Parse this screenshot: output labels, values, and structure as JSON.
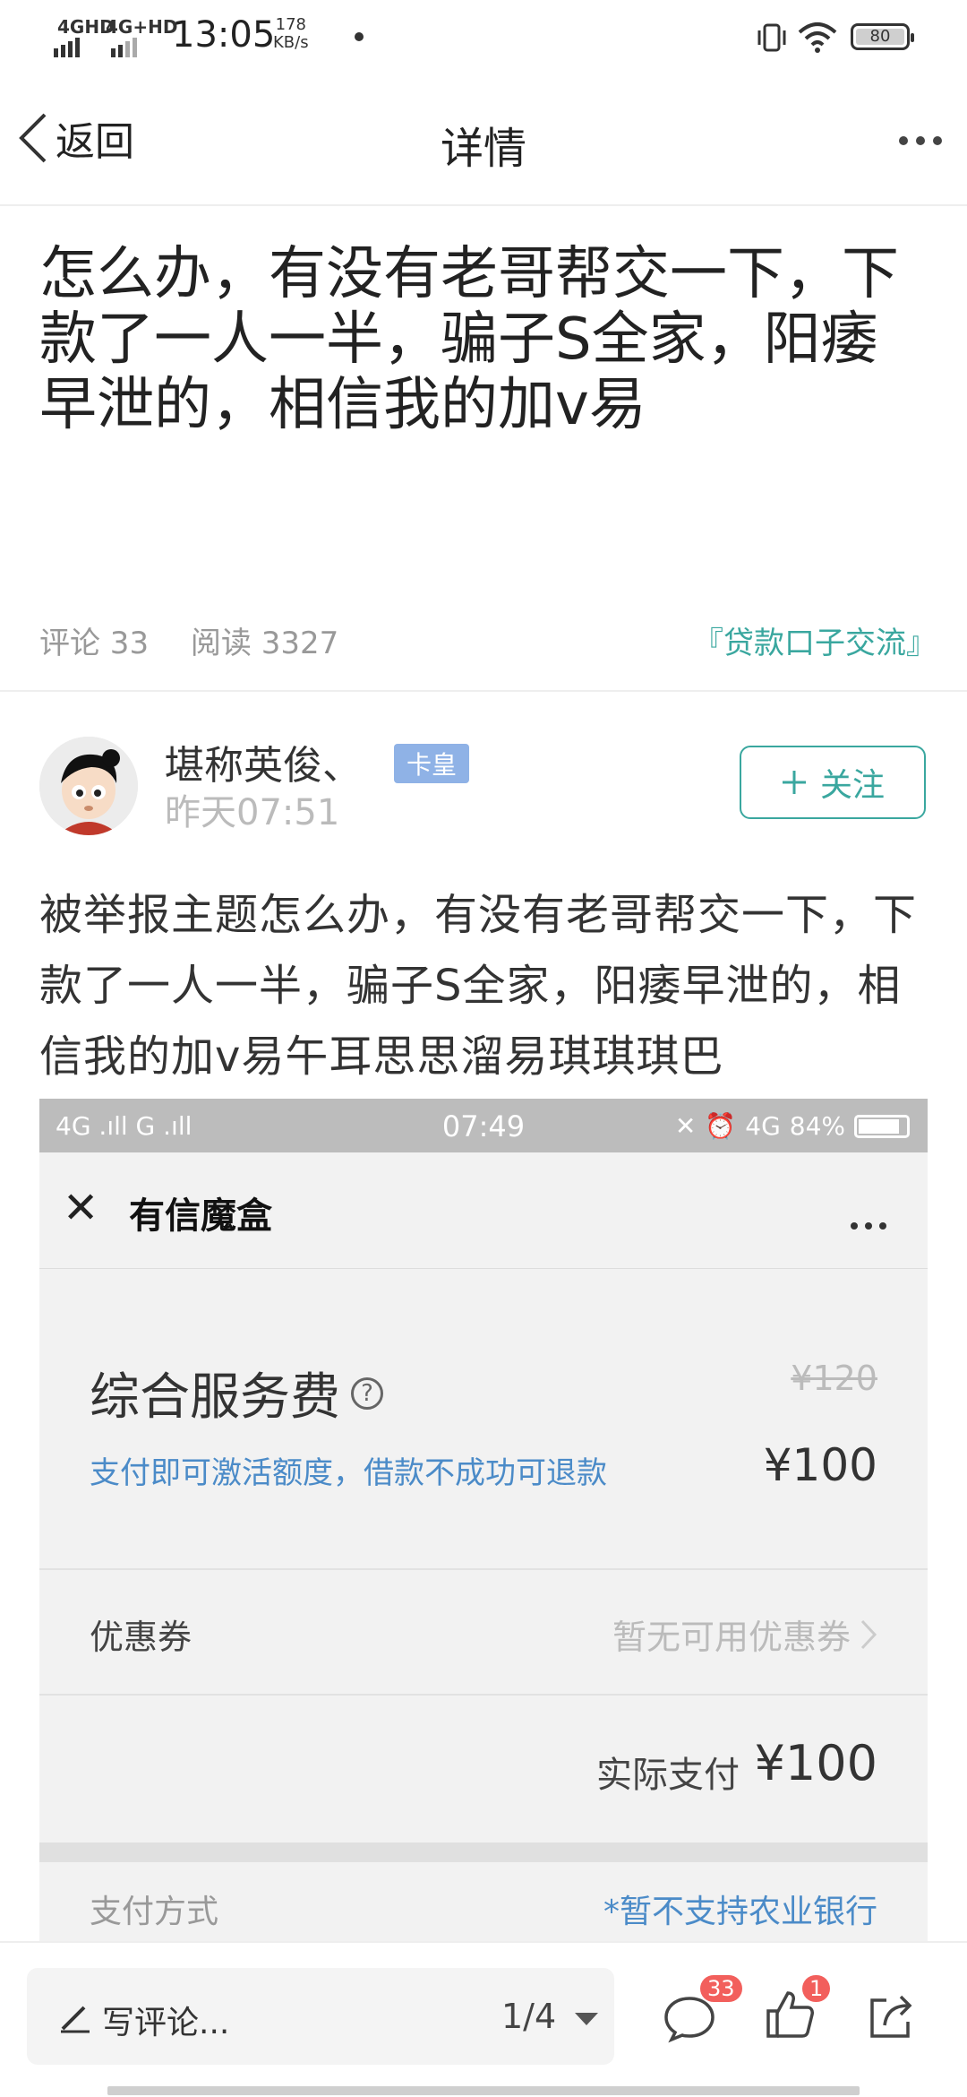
{
  "status": {
    "net1": "4GHD",
    "net2": "4G+HD",
    "time": "13:05",
    "speed_value": "178",
    "speed_unit": "KB/s",
    "battery": "80"
  },
  "nav": {
    "back_label": "返回",
    "title": "详情"
  },
  "post": {
    "title": "怎么办，有没有老哥帮交一下，下款了一人一半，骗子S全家，阳痿早泄的，相信我的加v易",
    "comments_label": "评论 33",
    "reads_label": "阅读 3327",
    "topic": "『贷款口子交流』",
    "author": {
      "name": "堪称英俊、",
      "badge": "卡皇",
      "time": "昨天07:51",
      "follow_label": "关注"
    },
    "body": "被举报主题怎么办，有没有老哥帮交一下，下款了一人一半，骗子S全家，阳痿早泄的，相信我的加v易午耳思思溜易琪琪琪巴"
  },
  "screenshot": {
    "status_left": "4G .ıll  G .ıll",
    "status_time": "07:49",
    "status_net": "4G",
    "status_battery": "84%",
    "title": "有信魔盒",
    "fee_label": "综合服务费",
    "fee_note": "支付即可激活额度，借款不成功可退款",
    "fee_original": "¥120",
    "fee_price": "¥100",
    "coupon_label": "优惠券",
    "coupon_value": "暂无可用优惠券",
    "actual_pay_label": "实际支付",
    "actual_pay_value": "¥100",
    "pay_method_label": "支付方式",
    "pay_method_note": "*暂不支持农业银行"
  },
  "bottom": {
    "comment_placeholder": "写评论...",
    "pager": "1/4",
    "comment_count": "33",
    "like_count": "1"
  },
  "colors": {
    "accent": "#3aa79f",
    "badge": "#8fb2e6",
    "link_blue": "#4b8bc8",
    "notification_red": "#f25f5c"
  }
}
